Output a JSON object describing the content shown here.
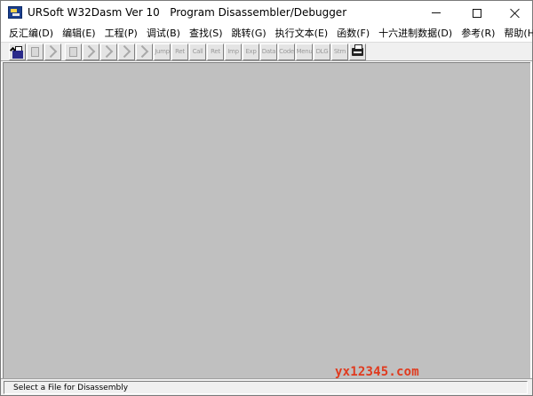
{
  "window": {
    "title": "URSoft W32Dasm Ver 10   Program Disassembler/Debugger",
    "icon": "w32dasm-app-icon",
    "controls": {
      "minimize_icon": "minimize-icon",
      "maximize_icon": "maximize-icon",
      "close_icon": "close-icon"
    }
  },
  "menu": {
    "items": [
      {
        "label": "反汇编(D)"
      },
      {
        "label": "编辑(E)"
      },
      {
        "label": "工程(P)"
      },
      {
        "label": "调试(B)"
      },
      {
        "label": "查找(S)"
      },
      {
        "label": "跳转(G)"
      },
      {
        "label": "执行文本(E)"
      },
      {
        "label": "函数(F)"
      },
      {
        "label": "十六进制数据(D)"
      },
      {
        "label": "参考(R)"
      },
      {
        "label": "帮助(H)"
      }
    ]
  },
  "toolbar": {
    "buttons": [
      {
        "icon": "open-file-icon",
        "enabled": true
      },
      {
        "icon": "save-disassembly-icon",
        "enabled": false
      },
      {
        "icon": "find-text-icon",
        "enabled": false
      },
      {
        "icon": "copy-lines-icon",
        "enabled": false
      },
      {
        "icon": "goto-code-start-icon",
        "enabled": false
      },
      {
        "icon": "goto-entry-point-icon",
        "enabled": false
      },
      {
        "icon": "goto-page-icon",
        "enabled": false
      },
      {
        "icon": "goto-code-location-icon",
        "enabled": false
      },
      {
        "icon": "execute-jump-icon",
        "enabled": false
      },
      {
        "icon": "return-from-jump-icon",
        "enabled": false
      },
      {
        "icon": "execute-call-icon",
        "enabled": false
      },
      {
        "icon": "return-from-call-icon",
        "enabled": false
      },
      {
        "icon": "imports-icon",
        "enabled": false
      },
      {
        "icon": "exports-icon",
        "enabled": false
      },
      {
        "icon": "data-hex-icon",
        "enabled": false
      },
      {
        "icon": "code-hex-icon",
        "enabled": false
      },
      {
        "icon": "menu-refs-icon",
        "enabled": false
      },
      {
        "icon": "dialog-refs-icon",
        "enabled": false
      },
      {
        "icon": "string-refs-icon",
        "enabled": false
      },
      {
        "icon": "print-icon",
        "enabled": true
      }
    ],
    "button_glyphs": {
      "imports": "Imp",
      "exports": "Exp",
      "data": "Data",
      "code": "Code",
      "menu": "Menu",
      "dlg": "DLG",
      "strn": "Strn",
      "ret": "Ret",
      "call": "Call",
      "jump": "Jump"
    }
  },
  "status": {
    "text": "Select a File for Disassembly"
  },
  "watermark": {
    "text": "yx12345.com"
  },
  "colors": {
    "client_background": "#c0c0c0",
    "toolbar_background": "#f0f0f0",
    "watermark": "#e03a1e"
  }
}
